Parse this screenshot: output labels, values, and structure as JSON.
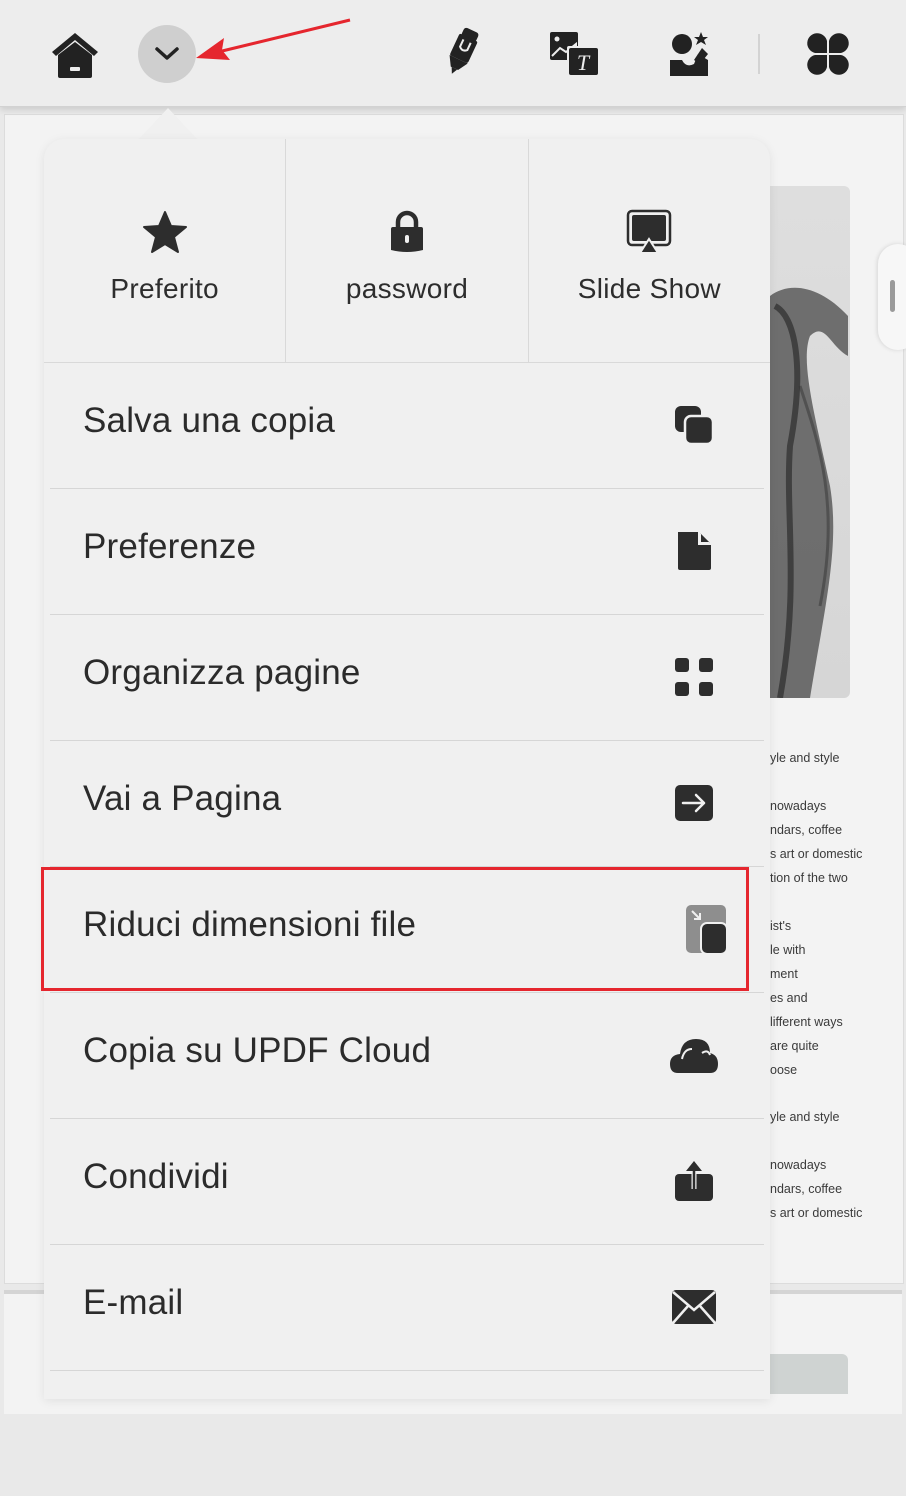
{
  "toolbar": {
    "buttons": [
      {
        "icon": "home-icon",
        "label": "Home"
      },
      {
        "icon": "chevron-down-icon",
        "label": "More",
        "active": true
      },
      {
        "icon": "highlighter-icon",
        "label": "Comment"
      },
      {
        "icon": "image-text-icon",
        "label": "Edit"
      },
      {
        "icon": "ai-assistant-icon",
        "label": "AI"
      },
      {
        "icon": "apps-grid-icon",
        "label": "Tools"
      }
    ]
  },
  "annotation": {
    "color": "#e5262e"
  },
  "popover": {
    "quick_actions": [
      {
        "icon": "star-icon",
        "label": "Preferito"
      },
      {
        "icon": "lock-icon",
        "label": "password"
      },
      {
        "icon": "slideshow-icon",
        "label": "Slide Show"
      }
    ],
    "items": [
      {
        "label": "Salva una copia",
        "icon": "copy-icon"
      },
      {
        "label": "Preferenze",
        "icon": "document-icon"
      },
      {
        "label": "Organizza pagine",
        "icon": "grid-icon"
      },
      {
        "label": "Vai a Pagina",
        "icon": "go-to-page-icon"
      },
      {
        "label": "Riduci dimensioni file",
        "icon": "compress-icon",
        "highlighted": true
      },
      {
        "label": "Copia su UPDF Cloud",
        "icon": "cloud-icon"
      },
      {
        "label": "Condividi",
        "icon": "share-icon"
      },
      {
        "label": "E-mail",
        "icon": "mail-icon"
      }
    ]
  },
  "document": {
    "text_lines": [
      "yle and style",
      "nowadays",
      "ndars, coffee",
      "s art or domestic",
      "tion of the two",
      "ist's",
      "le with",
      "ment",
      "es and",
      "lifferent ways",
      "are quite",
      "oose",
      "yle and style",
      "nowadays",
      "ndars, coffee",
      "s art or domestic"
    ]
  }
}
